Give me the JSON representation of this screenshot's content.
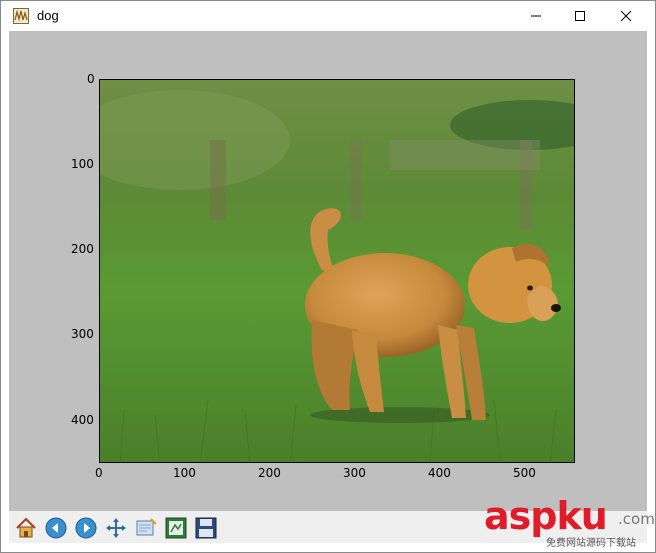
{
  "window": {
    "title": "dog",
    "app_icon": "matplotlib-figure-icon",
    "controls": [
      "minimize-icon",
      "maximize-icon",
      "close-icon"
    ]
  },
  "figure": {
    "background": "#bfbfbf",
    "image_content": "puppy standing on green grass",
    "x_ticks": [
      "0",
      "100",
      "200",
      "300",
      "400",
      "500"
    ],
    "y_ticks": [
      "0",
      "100",
      "200",
      "300",
      "400"
    ],
    "x_range": [
      0,
      560
    ],
    "y_range": [
      0,
      450
    ]
  },
  "toolbar": {
    "buttons": [
      {
        "name": "home-icon"
      },
      {
        "name": "back-icon"
      },
      {
        "name": "forward-icon"
      },
      {
        "name": "pan-icon"
      },
      {
        "name": "zoom-icon"
      },
      {
        "name": "configure-subplots-icon"
      },
      {
        "name": "save-icon"
      }
    ]
  },
  "watermark": {
    "main": "aspku",
    "domain": ".com",
    "sub": "免费网站源码下载站"
  },
  "colors": {
    "grass": "#4f8a2e",
    "dog": "#c78a3e",
    "watermark": "#e01c2b"
  }
}
